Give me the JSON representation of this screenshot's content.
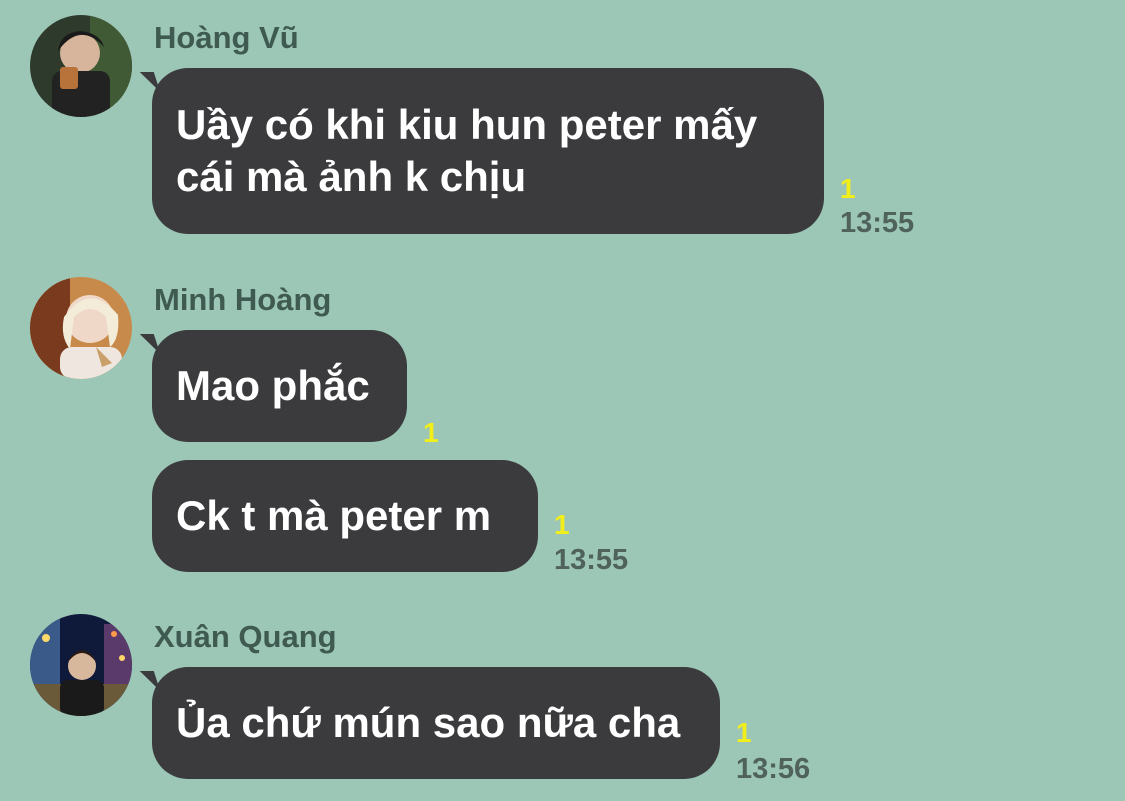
{
  "theme": {
    "background": "#9cc6b6",
    "bubble": "#3b3b3e",
    "read_count_color": "#f2ee1a",
    "name_color": "#3f5a50"
  },
  "messages": [
    {
      "sender": "Hoàng Vũ",
      "avatar_icon": "user-avatar-icon",
      "bubbles": [
        {
          "text": "Uầy có khi kiu hun peter mấy\ncái mà ảnh k chịu",
          "read": "1",
          "time": "13:55"
        }
      ]
    },
    {
      "sender": "Minh Hoàng",
      "avatar_icon": "user-avatar-icon",
      "bubbles": [
        {
          "text": "Mao phắc",
          "read": "1",
          "time": ""
        },
        {
          "text": "Ck t mà peter m",
          "read": "1",
          "time": "13:55"
        }
      ]
    },
    {
      "sender": "Xuân Quang",
      "avatar_icon": "user-avatar-icon",
      "bubbles": [
        {
          "text": "Ủa chứ mún sao nữa cha",
          "read": "1",
          "time": "13:56"
        }
      ]
    }
  ]
}
